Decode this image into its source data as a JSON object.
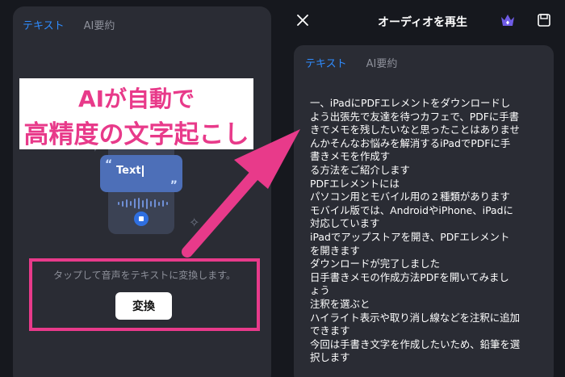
{
  "left": {
    "tabs": [
      {
        "label": "テキスト",
        "active": true
      },
      {
        "label": "AI要約",
        "active": false
      }
    ],
    "bubble_text": "Text",
    "banner": {
      "line1": "AIが自動で",
      "line2": "高精度の文字起こし"
    },
    "prompt": "タップして音声をテキストに変換します。",
    "convert_button": "変換"
  },
  "header": {
    "title": "オーディオを再生"
  },
  "right": {
    "tabs": [
      {
        "label": "テキスト",
        "active": true
      },
      {
        "label": "AI要約",
        "active": false
      }
    ],
    "transcript": [
      "一、iPadにPDFエレメントをダウンロードし",
      "よう出張先で友達を待つカフェで、PDFに手書",
      "きでメモを残したいなと思ったことはありませ",
      "んかそんなお悩みを解消するiPadでPDFに手",
      "書きメモを作成す",
      "る方法をご紹介します",
      "PDFエレメントには",
      "パソコン用とモバイル用の２種類があります",
      "モバイル版では、AndroidやiPhone、iPadに",
      "対応しています",
      "iPadでアップストアを開き、PDFエレメント",
      "を開きます",
      "ダウンロードが完了しました",
      "日手書きメモの作成方法PDFを開いてみまし",
      "ょう",
      "注釈を選ぶと",
      "ハイライト表示や取り消し線などを注釈に追加",
      "できます",
      "今回は手書き文字を作成したいため、鉛筆を選",
      "択します"
    ]
  },
  "colors": {
    "accent_blue": "#2f8cff",
    "highlight_pink": "#e83a8a",
    "panel_bg": "#2a2c34",
    "page_bg": "#16181e"
  },
  "icons": [
    "close-icon",
    "crown-icon",
    "save-icon"
  ]
}
